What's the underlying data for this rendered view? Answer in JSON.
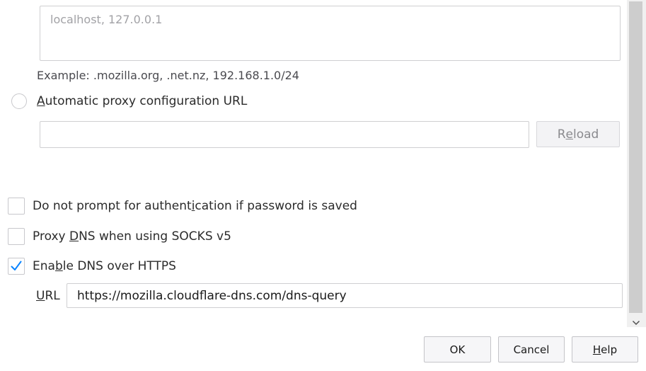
{
  "no_proxy": {
    "placeholder": "localhost, 127.0.0.1",
    "example": "Example: .mozilla.org, .net.nz, 192.168.1.0/24"
  },
  "auto_proxy": {
    "radio_label_accesskey": "A",
    "radio_label_rest": "utomatic proxy configuration URL",
    "url_value": "",
    "reload": {
      "pre": "R",
      "accesskey": "e",
      "post": "load"
    }
  },
  "checkboxes": [
    {
      "pre": "Do not prompt for authent",
      "accesskey": "i",
      "post": "cation if password is saved",
      "checked": false
    },
    {
      "pre": "Proxy ",
      "accesskey": "D",
      "post": "NS when using SOCKS v5",
      "checked": false
    },
    {
      "pre": "Ena",
      "accesskey": "b",
      "post": "le DNS over HTTPS",
      "checked": true
    }
  ],
  "doh": {
    "url_label_accesskey": "U",
    "url_label_rest": "RL",
    "url_value": "https://mozilla.cloudflare-dns.com/dns-query"
  },
  "buttons": {
    "ok": "OK",
    "cancel": "Cancel",
    "help_accesskey": "H",
    "help_rest": "elp"
  },
  "colors": {
    "check_mark": "#0a84ff",
    "scrollbar_thumb": "#cdcdcd"
  },
  "icons": {
    "checkmark": "checkmark-icon",
    "scroll_down": "chevron-down-icon"
  }
}
